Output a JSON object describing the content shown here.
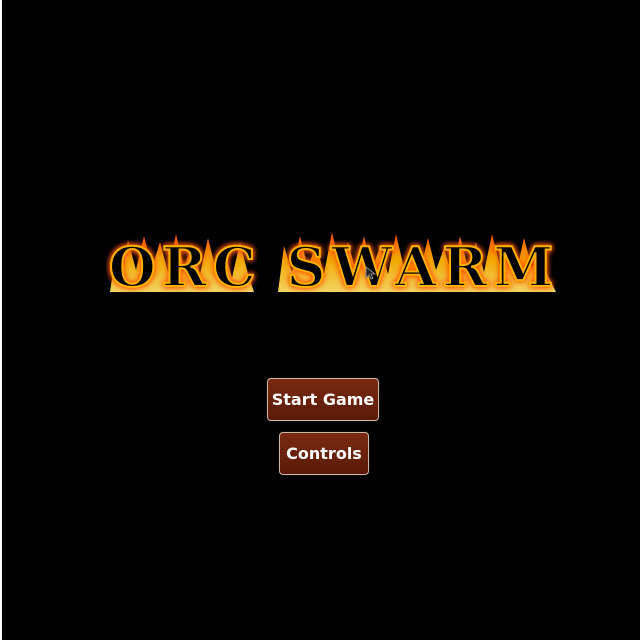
{
  "title": {
    "text": "ORC SWARM"
  },
  "menu": {
    "start_label": "Start Game",
    "controls_label": "Controls"
  },
  "colors": {
    "background": "#000000",
    "button_fill": "#6a2210",
    "button_border": "#c9b8a8",
    "flame_outer": "#ff6a00",
    "flame_inner": "#ffd23a",
    "letter_fill": "#000000"
  },
  "icons": {
    "cursor": "cursor-icon"
  }
}
